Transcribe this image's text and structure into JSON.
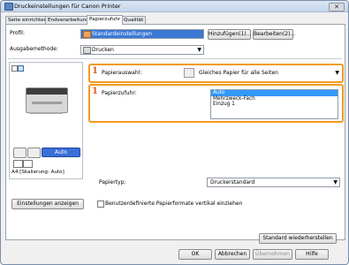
{
  "window": {
    "title": "Druckeinstellungen für Canon Printer",
    "close_icon": "close-icon"
  },
  "tabs": [
    {
      "label": "Seite einrichten"
    },
    {
      "label": "Endverarbeitung"
    },
    {
      "label": "Papierzufuhr"
    },
    {
      "label": "Qualität"
    }
  ],
  "active_tab": "Papierzufuhr",
  "profile": {
    "label": "Profil:",
    "value": "Standardeinstellungen",
    "add_button": "Hinzufügen(1)...",
    "edit_button": "Bearbeiten(2)..."
  },
  "output": {
    "label": "Ausgabemethode:",
    "value": "Drucken"
  },
  "paper_selection": {
    "label": "Papierauswahl:",
    "value": "Gleiches Papier für alle Seiten",
    "badge": "1"
  },
  "paper_source": {
    "label": "Papierzufuhr:",
    "badge": "1",
    "options": [
      "Auto",
      "Mehrzweck-Fach",
      "Einzug 1"
    ],
    "selected": "Auto"
  },
  "preview": {
    "auto_button": "Auto",
    "size_text": "A4 [Skalierung: Auto]"
  },
  "paper_type": {
    "label": "Papiertyp:",
    "value": "Druckerstandard"
  },
  "settings_button": "Einstellungen anzeigen",
  "custom_vertical": {
    "label": "Benutzerdefinierte Papierformate vertikal einziehen",
    "checked": false
  },
  "restore_button": "Standard wiederherstellen",
  "footer": {
    "ok": "OK",
    "cancel": "Abbrechen",
    "apply": "Übernehmen",
    "help": "Hilfe"
  },
  "colors": {
    "accent": "#f29a1f",
    "number": "#e65a1a",
    "selection": "#3399ff"
  }
}
